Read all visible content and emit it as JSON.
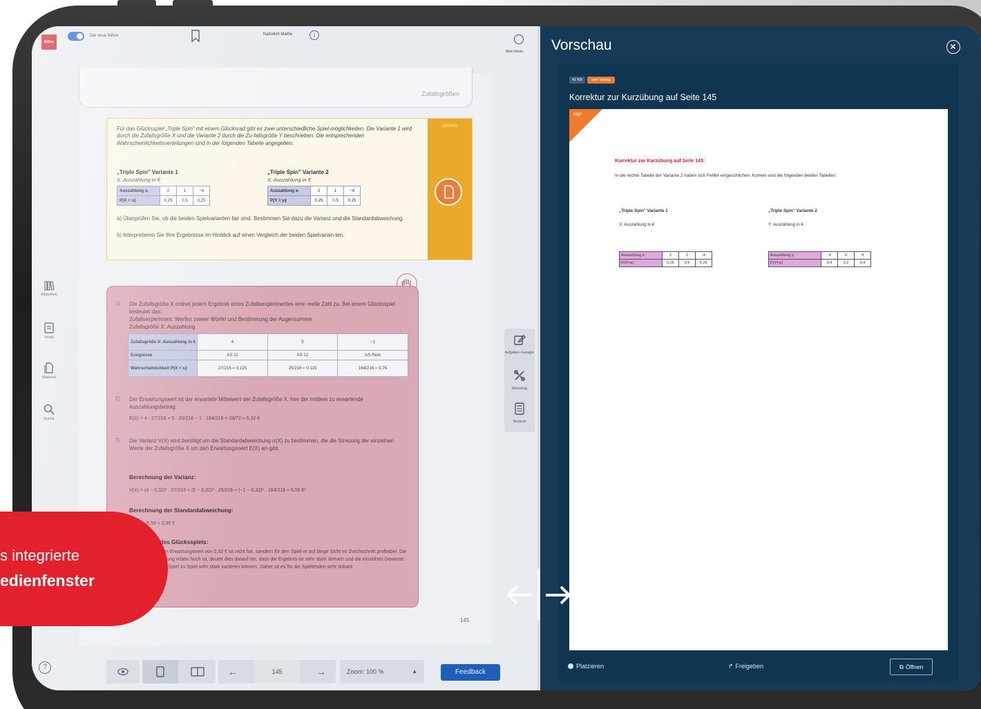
{
  "reader": {
    "toggle_label": "Die neue BiBox",
    "book_title": "Natürlich Mathe",
    "account_label": "Mein Konto",
    "logo_text": "BiBox",
    "nav": [
      {
        "label": "Bibliothek"
      },
      {
        "label": "Inhalt"
      },
      {
        "label": "Material"
      },
      {
        "label": "Suche"
      }
    ],
    "page_header": "Zufallsgrößen",
    "exercise": {
      "tab_label": "ÜBUNG",
      "intro": "Für das Glücksspiel „Triple Spin\" mit einem Glücksrad gibt es zwei unterschiedliche Spiel-möglichkeiten. Die Variante 1 wird durch die Zufallsgröße X und die Variante 2 durch die Zu-fallsgröße Y beschrieben. Die entsprechenden Wahrscheinlichkeitsverteilungen sind in der folgenden Tabelle angegeben.",
      "v1_title": "„Triple Spin\" Variante 1",
      "v1_sub": "X: Auszahlung in €",
      "v2_title": "„Triple Spin\" Variante 2",
      "v2_sub": "X: Auszahlung in €",
      "t1": {
        "label1": "Auszahlung xᵢ",
        "label2": "P(X = xᵢ)",
        "row1": [
          "2",
          "1",
          "−4"
        ],
        "row2": [
          "0,25",
          "0,5",
          "0,25"
        ]
      },
      "t2": {
        "label1": "Auszahlung xᵢ",
        "label2": "P(Y = yᵢ)",
        "row1": [
          "2",
          "1",
          "−4"
        ],
        "row2": [
          "0,25",
          "0,5",
          "0,25"
        ]
      },
      "a": "a) Überprüfen Sie, ob die beiden Spielvarianten fair sind. Bestimmen Sie dazu die Varianz und die Standardabweichung.",
      "b": "b) Interpretieren Sie Ihre Ergebnisse im Hinblick auf einen Vergleich der beiden Spielvarian-ten."
    },
    "solution": {
      "n1": "1)",
      "p1": "Die Zufallsgröße X ordnet jedem Ergebnis eines Zufallsexperimentes eine reelle Zahl zu. Bei einem Glücksspiel bedeutet das:",
      "p1b": "Zufallsexperiment: Werfen zweier Würfel und Bestimmung der Augensumme",
      "p1c": "Zufallsgröße X:      Auszahlung",
      "table": {
        "r1_label": "Zufallsgröße X: Auszahlung in €",
        "r1": [
          "4",
          "5",
          "−1"
        ],
        "r2_label": "Ereignisse",
        "r2": [
          "AS 11",
          "AS 12",
          "AS Rest"
        ],
        "r3_label": "Wahrscheinlichkeit P(X = xᵢ)",
        "r3": [
          "27/216 ≈ 0,125",
          "25/216 ≈ 0,115",
          "164/216 ≈ 0,76"
        ]
      },
      "n2": "2)",
      "p2": "Der Erwartungswert ist der erwartete Mittelwert der Zufallsgröße X, hier der mittlere zu erwartende Auszahlungsbetrag:",
      "p2f": "E(X) = 4 · 27/216 + 5 · 25/216 − 1 · 164/216 = 23/72 ≈ 0,32 €",
      "n3": "3)",
      "p3": "Die Varianz V(X) wird benötigt um die Standardabweichung σ(X) zu bestimmen, die die Streuung der einzelnen Werte der Zufallsgröße X um den Erwartungswert E(X) an-gibt.",
      "h_var": "Berechnung der Varianz:",
      "f_var": "V(X) = (4 − 0,32)² · 27/216 + (5 − 0,32)² · 25/216 + (−1 − 0,32)² · 164/216 ≈ 5,55 €²",
      "h_std": "Berechnung der Standardabweichung:",
      "f_std": "σ(X) = √5,55 ≈ 2,35 €",
      "h_eval": "Bewertung des Glücksspiels:",
      "p_eval": "Das Spiel mit dem Erwartungswert von 0,32 € ist nicht fair, sondern für den Spiel-er auf lange Sicht im Durchschnitt profitabel. Die Standardabweichung relativ hoch ist, deutet dies darauf hin, dass die Ergebnis-se sehr stark streuen und die einzelnen Gewinne oder Verluste von Spiel zu Spiel sehr stark variieren können. Daher ist es für die Spielenden sehr riskant."
    },
    "page_number": "145",
    "tools": [
      {
        "label": "Aufgaben-manager"
      },
      {
        "label": "Werkzeug"
      },
      {
        "label": "Rechner"
      }
    ],
    "bottombar": {
      "page_input": "145",
      "zoom": "Zoom: 100 %",
      "feedback": "Feedback"
    },
    "help": "?"
  },
  "preview": {
    "title": "Vorschau",
    "size": "42 KB",
    "badge": "vom Verlag",
    "doc_title": "Korrektur zur Kurzübung auf Seite 145",
    "doc": {
      "corner": "PDF",
      "heading": "Korrektur zur Kurzübung auf Seite 145:",
      "para": "In die rechte Tabelle der Variante 2 haben sich Fehler eingeschlichen. Korrekt sind die folgenden beiden Tabellen:",
      "v1_title": "„Triple Spin\" Variante 1",
      "v1_sub": "X: Auszahlung in €",
      "v2_title": "„Triple Spin\" Variante 2",
      "v2_sub": "Y: Auszahlung in €",
      "t1": {
        "label1": "Auszahlung xᵢ",
        "label2": "P(X=xᵢ)",
        "row1": [
          "2",
          "1",
          "-4"
        ],
        "row2": [
          "0,25",
          "0,5",
          "0,25"
        ]
      },
      "t2": {
        "label1": "Auszahlung yᵢ",
        "label2": "P(Y=yᵢ)",
        "row1": [
          "-4",
          "0",
          "4"
        ],
        "row2": [
          "0,4",
          "0,2",
          "0,4"
        ]
      }
    },
    "actions": {
      "place": "Platzieren",
      "share": "Freigeben",
      "open": "Öffnen"
    }
  },
  "callout": {
    "line1": "s integrierte",
    "line2": "edienfenster"
  }
}
